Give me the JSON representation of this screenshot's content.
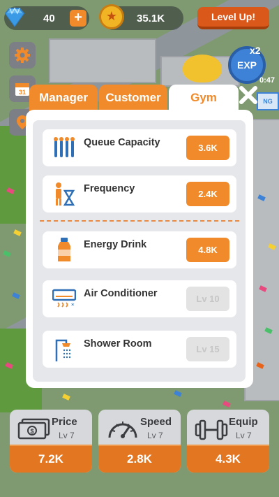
{
  "topbar": {
    "gems": "40",
    "plus_label": "+",
    "coins": "35.1K",
    "levelup_label": "Level Up!"
  },
  "exp": {
    "multiplier": "x2",
    "label": "EXP",
    "timer": "0:47"
  },
  "tabs": [
    {
      "label": "Manager"
    },
    {
      "label": "Customer"
    },
    {
      "label": "Gym"
    }
  ],
  "active_tab": "Gym",
  "upgrades": [
    {
      "name": "Queue Capacity",
      "value": "3.6K",
      "icon": "queue-icon",
      "locked": false
    },
    {
      "name": "Frequency",
      "value": "2.4K",
      "icon": "hourglass-person-icon",
      "locked": false
    },
    {
      "name": "Energy Drink",
      "value": "4.8K",
      "icon": "bottle-icon",
      "locked": false
    },
    {
      "name": "Air Conditioner",
      "value": "Lv 10",
      "icon": "air-conditioner-icon",
      "locked": true
    },
    {
      "name": "Shower Room",
      "value": "Lv 15",
      "icon": "shower-icon",
      "locked": true
    }
  ],
  "cards": [
    {
      "title": "Price",
      "level": "Lv 7",
      "cost": "7.2K",
      "icon": "cash-icon"
    },
    {
      "title": "Speed",
      "level": "Lv 7",
      "cost": "2.8K",
      "icon": "speedometer-icon"
    },
    {
      "title": "Equip",
      "level": "Lv 7",
      "cost": "4.3K",
      "icon": "dumbbell-icon"
    }
  ],
  "colors": {
    "accent": "#f08a2a",
    "card_button": "#e37621",
    "locked_button": "#e3e3e3",
    "panel_bg": "#e6e7ea"
  }
}
